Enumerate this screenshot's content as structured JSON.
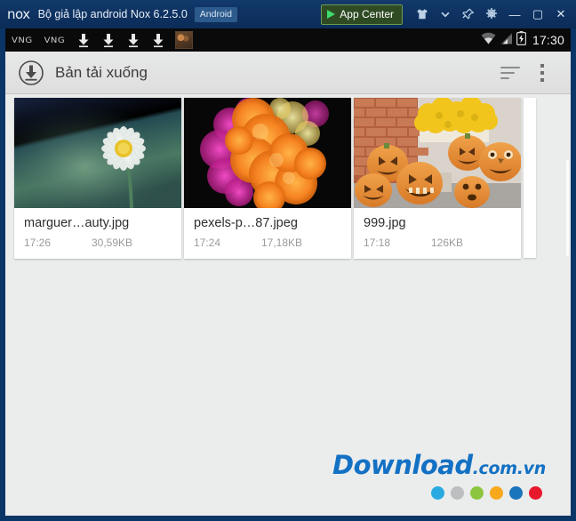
{
  "titlebar": {
    "logo": "nox",
    "title": "Bộ giả lập android Nox 6.2.5.0",
    "badge": "Android",
    "app_center_label": "App Center",
    "icons": [
      {
        "name": "tshirt-icon",
        "glyph": "tshirt"
      },
      {
        "name": "chevron-down-icon",
        "glyph": "chevron-down"
      },
      {
        "name": "pin-icon",
        "glyph": "pin"
      },
      {
        "name": "gear-icon",
        "glyph": "gear"
      }
    ],
    "window_controls": {
      "minimize": "—",
      "maximize": "▢",
      "close": "✕"
    }
  },
  "statusbar": {
    "notifications": [
      {
        "name": "vng-notification-icon",
        "label": "VNG"
      },
      {
        "name": "vng-notification-icon",
        "label": "VNG"
      },
      {
        "name": "download-notification-icon",
        "label": "download"
      },
      {
        "name": "download-notification-icon",
        "label": "download"
      },
      {
        "name": "download-notification-icon",
        "label": "download"
      },
      {
        "name": "download-notification-icon",
        "label": "download"
      },
      {
        "name": "image-notification-icon",
        "label": "image"
      }
    ],
    "wifi_icon": "wifi-icon",
    "signal_icon": "cellular-signal-icon",
    "battery_icon": "battery-charging-icon",
    "clock": "17:30"
  },
  "actionbar": {
    "icon": "download-circle-icon",
    "title": "Bản tải xuống",
    "sort_icon": "sort-icon",
    "overflow_icon": "overflow-menu-icon"
  },
  "downloads": {
    "items": [
      {
        "name": "marguer…auty.jpg",
        "time": "17:26",
        "size": "30,59KB",
        "thumb": "daisy-flower-thumbnail"
      },
      {
        "name": "pexels-p…87.jpeg",
        "time": "17:24",
        "size": "17,18KB",
        "thumb": "orange-ink-thumbnail"
      },
      {
        "name": "999.jpg",
        "time": "17:18",
        "size": "126KB",
        "thumb": "halloween-pumpkins-thumbnail"
      }
    ]
  },
  "watermark": {
    "brand": "Download",
    "tld": ".com.vn",
    "dot_colors": [
      "#29abe2",
      "#bcbec0",
      "#8cc63f",
      "#f7a81b",
      "#1b75bc",
      "#e8192c"
    ]
  },
  "colors": {
    "titlebar": "#0e3160",
    "frame": "#0b3566",
    "statusbar": "#0a0a0a",
    "actionbar": "#e2e3e3",
    "content_bg": "#ebecec",
    "card_bg": "#ffffff",
    "accent_green": "#3ddc6d",
    "brand_blue": "#1271c4"
  }
}
